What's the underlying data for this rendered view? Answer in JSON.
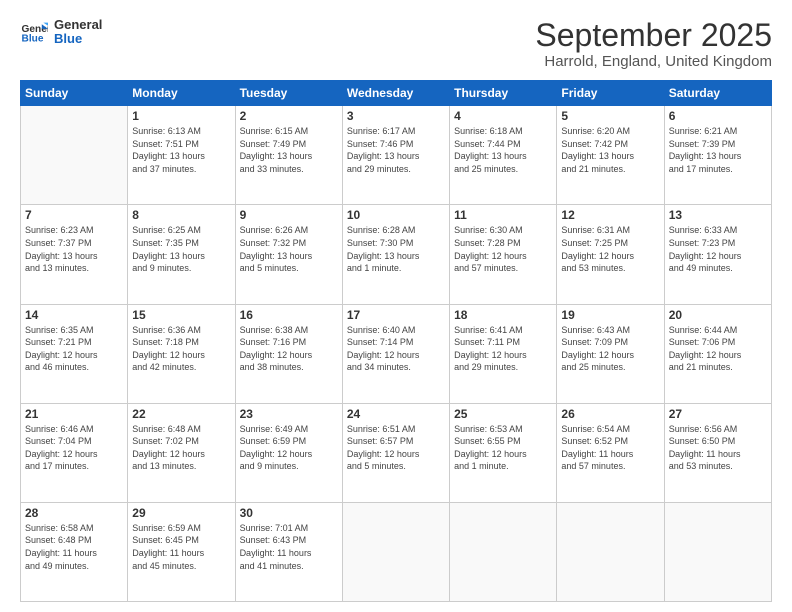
{
  "logo": {
    "line1": "General",
    "line2": "Blue"
  },
  "title": "September 2025",
  "subtitle": "Harrold, England, United Kingdom",
  "days_of_week": [
    "Sunday",
    "Monday",
    "Tuesday",
    "Wednesday",
    "Thursday",
    "Friday",
    "Saturday"
  ],
  "weeks": [
    [
      {
        "day": "",
        "info": ""
      },
      {
        "day": "1",
        "info": "Sunrise: 6:13 AM\nSunset: 7:51 PM\nDaylight: 13 hours\nand 37 minutes."
      },
      {
        "day": "2",
        "info": "Sunrise: 6:15 AM\nSunset: 7:49 PM\nDaylight: 13 hours\nand 33 minutes."
      },
      {
        "day": "3",
        "info": "Sunrise: 6:17 AM\nSunset: 7:46 PM\nDaylight: 13 hours\nand 29 minutes."
      },
      {
        "day": "4",
        "info": "Sunrise: 6:18 AM\nSunset: 7:44 PM\nDaylight: 13 hours\nand 25 minutes."
      },
      {
        "day": "5",
        "info": "Sunrise: 6:20 AM\nSunset: 7:42 PM\nDaylight: 13 hours\nand 21 minutes."
      },
      {
        "day": "6",
        "info": "Sunrise: 6:21 AM\nSunset: 7:39 PM\nDaylight: 13 hours\nand 17 minutes."
      }
    ],
    [
      {
        "day": "7",
        "info": "Sunrise: 6:23 AM\nSunset: 7:37 PM\nDaylight: 13 hours\nand 13 minutes."
      },
      {
        "day": "8",
        "info": "Sunrise: 6:25 AM\nSunset: 7:35 PM\nDaylight: 13 hours\nand 9 minutes."
      },
      {
        "day": "9",
        "info": "Sunrise: 6:26 AM\nSunset: 7:32 PM\nDaylight: 13 hours\nand 5 minutes."
      },
      {
        "day": "10",
        "info": "Sunrise: 6:28 AM\nSunset: 7:30 PM\nDaylight: 13 hours\nand 1 minute."
      },
      {
        "day": "11",
        "info": "Sunrise: 6:30 AM\nSunset: 7:28 PM\nDaylight: 12 hours\nand 57 minutes."
      },
      {
        "day": "12",
        "info": "Sunrise: 6:31 AM\nSunset: 7:25 PM\nDaylight: 12 hours\nand 53 minutes."
      },
      {
        "day": "13",
        "info": "Sunrise: 6:33 AM\nSunset: 7:23 PM\nDaylight: 12 hours\nand 49 minutes."
      }
    ],
    [
      {
        "day": "14",
        "info": "Sunrise: 6:35 AM\nSunset: 7:21 PM\nDaylight: 12 hours\nand 46 minutes."
      },
      {
        "day": "15",
        "info": "Sunrise: 6:36 AM\nSunset: 7:18 PM\nDaylight: 12 hours\nand 42 minutes."
      },
      {
        "day": "16",
        "info": "Sunrise: 6:38 AM\nSunset: 7:16 PM\nDaylight: 12 hours\nand 38 minutes."
      },
      {
        "day": "17",
        "info": "Sunrise: 6:40 AM\nSunset: 7:14 PM\nDaylight: 12 hours\nand 34 minutes."
      },
      {
        "day": "18",
        "info": "Sunrise: 6:41 AM\nSunset: 7:11 PM\nDaylight: 12 hours\nand 29 minutes."
      },
      {
        "day": "19",
        "info": "Sunrise: 6:43 AM\nSunset: 7:09 PM\nDaylight: 12 hours\nand 25 minutes."
      },
      {
        "day": "20",
        "info": "Sunrise: 6:44 AM\nSunset: 7:06 PM\nDaylight: 12 hours\nand 21 minutes."
      }
    ],
    [
      {
        "day": "21",
        "info": "Sunrise: 6:46 AM\nSunset: 7:04 PM\nDaylight: 12 hours\nand 17 minutes."
      },
      {
        "day": "22",
        "info": "Sunrise: 6:48 AM\nSunset: 7:02 PM\nDaylight: 12 hours\nand 13 minutes."
      },
      {
        "day": "23",
        "info": "Sunrise: 6:49 AM\nSunset: 6:59 PM\nDaylight: 12 hours\nand 9 minutes."
      },
      {
        "day": "24",
        "info": "Sunrise: 6:51 AM\nSunset: 6:57 PM\nDaylight: 12 hours\nand 5 minutes."
      },
      {
        "day": "25",
        "info": "Sunrise: 6:53 AM\nSunset: 6:55 PM\nDaylight: 12 hours\nand 1 minute."
      },
      {
        "day": "26",
        "info": "Sunrise: 6:54 AM\nSunset: 6:52 PM\nDaylight: 11 hours\nand 57 minutes."
      },
      {
        "day": "27",
        "info": "Sunrise: 6:56 AM\nSunset: 6:50 PM\nDaylight: 11 hours\nand 53 minutes."
      }
    ],
    [
      {
        "day": "28",
        "info": "Sunrise: 6:58 AM\nSunset: 6:48 PM\nDaylight: 11 hours\nand 49 minutes."
      },
      {
        "day": "29",
        "info": "Sunrise: 6:59 AM\nSunset: 6:45 PM\nDaylight: 11 hours\nand 45 minutes."
      },
      {
        "day": "30",
        "info": "Sunrise: 7:01 AM\nSunset: 6:43 PM\nDaylight: 11 hours\nand 41 minutes."
      },
      {
        "day": "",
        "info": ""
      },
      {
        "day": "",
        "info": ""
      },
      {
        "day": "",
        "info": ""
      },
      {
        "day": "",
        "info": ""
      }
    ]
  ]
}
